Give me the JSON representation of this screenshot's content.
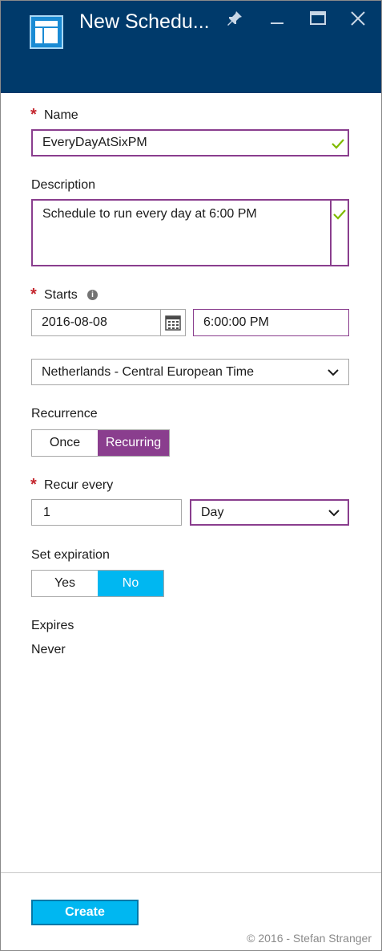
{
  "header": {
    "title": "New Schedu...",
    "icons": [
      "blade-icon",
      "pin-icon",
      "minimize-icon",
      "maximize-icon",
      "close-icon"
    ]
  },
  "form": {
    "name": {
      "label": "Name",
      "required_mark": "*",
      "value": "EveryDayAtSixPM"
    },
    "description": {
      "label": "Description",
      "value": "Schedule to run every day at 6:00 PM"
    },
    "starts": {
      "label": "Starts",
      "required_mark": "*",
      "info_icon": "i",
      "date": "2016-08-08",
      "time": "6:00:00 PM"
    },
    "timezone": {
      "selected": "Netherlands - Central European Time"
    },
    "recurrence": {
      "label": "Recurrence",
      "options": [
        "Once",
        "Recurring"
      ],
      "selected": "Recurring"
    },
    "recur_every": {
      "label": "Recur every",
      "required_mark": "*",
      "value": "1",
      "unit": "Day"
    },
    "expiration": {
      "label": "Set expiration",
      "options": [
        "Yes",
        "No"
      ],
      "selected": "No"
    },
    "expires": {
      "label": "Expires",
      "value": "Never"
    }
  },
  "footer": {
    "create_label": "Create",
    "copyright": "© 2016 - Stefan Stranger"
  },
  "colors": {
    "header_bg": "#003a6b",
    "accent_purple": "#8a3e8e",
    "accent_blue": "#00b7f1",
    "check_green": "#7fba00",
    "required_red": "#c4262e"
  }
}
